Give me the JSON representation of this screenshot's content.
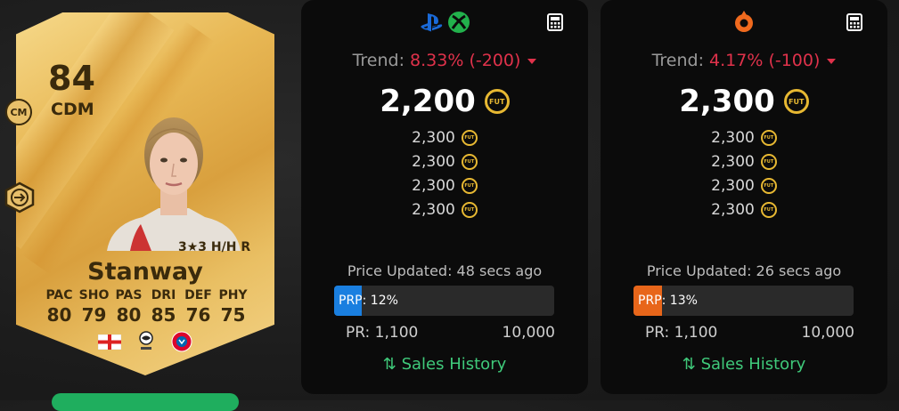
{
  "card": {
    "rating": "84",
    "position": "CDM",
    "alt_position": "CM",
    "skills_text": "3★3 H/H R",
    "name": "Stanway",
    "stats": [
      {
        "label": "PAC",
        "value": "80"
      },
      {
        "label": "SHO",
        "value": "79"
      },
      {
        "label": "PAS",
        "value": "80"
      },
      {
        "label": "DRI",
        "value": "85"
      },
      {
        "label": "DEF",
        "value": "76"
      },
      {
        "label": "PHY",
        "value": "75"
      }
    ],
    "colors": {
      "gold": "#e8b855",
      "text": "#3a2a0c"
    }
  },
  "panels": [
    {
      "platform": "console",
      "icons": [
        "playstation-icon",
        "xbox-icon"
      ],
      "trend_label": "Trend:",
      "trend_value": "8.33% (-200)",
      "main_price": "2,200",
      "coin_label": "FUT",
      "prices": [
        "2,300",
        "2,300",
        "2,300",
        "2,300"
      ],
      "updated": "Price Updated: 48 secs ago",
      "prp_label": "PRP",
      "prp_value": ": 12%",
      "prp_percent": 12,
      "prp_color": "#1a7fe0",
      "pr_min": "PR: 1,100",
      "pr_max": "10,000",
      "sales_label": "Sales History"
    },
    {
      "platform": "pc",
      "icons": [
        "origin-icon"
      ],
      "trend_label": "Trend:",
      "trend_value": "4.17% (-100)",
      "main_price": "2,300",
      "coin_label": "FUT",
      "prices": [
        "2,300",
        "2,300",
        "2,300",
        "2,300"
      ],
      "updated": "Price Updated: 26 secs ago",
      "prp_label": "PRP",
      "prp_value": ": 13%",
      "prp_percent": 13,
      "prp_color": "#e8661a",
      "pr_min": "PR: 1,100",
      "pr_max": "10,000",
      "sales_label": "Sales History"
    }
  ],
  "colors": {
    "trend_down": "#e0324b",
    "sales_green": "#3fc97a",
    "coin_gold": "#e7b832"
  }
}
